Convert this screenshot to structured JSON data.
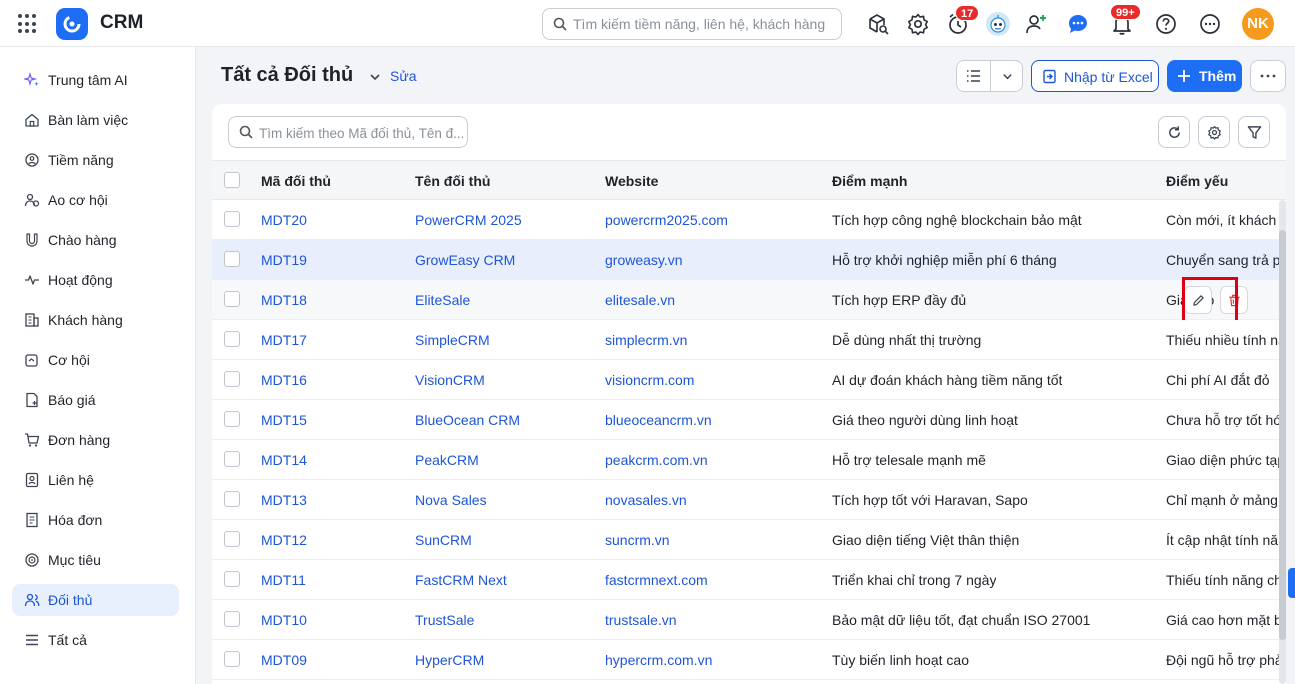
{
  "app": {
    "name": "CRM"
  },
  "topbar": {
    "search_placeholder": "Tìm kiếm tiềm năng, liên hệ, khách hàng",
    "reminder_badge": "17",
    "notification_badge": "99+",
    "user_initials": "NK",
    "icons": [
      "apps-grid-icon",
      "box-search-icon",
      "gear-icon",
      "alarm-clock-icon",
      "robot-avatar",
      "add-user-icon",
      "chat-icon",
      "bell-icon",
      "help-icon",
      "more-icon"
    ]
  },
  "sidebar": {
    "items": [
      {
        "label": "Trung tâm AI",
        "icon": "sparkle-icon"
      },
      {
        "label": "Bàn làm việc",
        "icon": "home-icon"
      },
      {
        "label": "Tiềm năng",
        "icon": "target-person-icon"
      },
      {
        "label": "Ao cơ hội",
        "icon": "people-pool-icon"
      },
      {
        "label": "Chào hàng",
        "icon": "magnet-icon"
      },
      {
        "label": "Hoạt động",
        "icon": "activity-icon"
      },
      {
        "label": "Khách hàng",
        "icon": "building-icon"
      },
      {
        "label": "Cơ hội",
        "icon": "opportunity-icon"
      },
      {
        "label": "Báo giá",
        "icon": "quote-icon"
      },
      {
        "label": "Đơn hàng",
        "icon": "cart-icon"
      },
      {
        "label": "Liên hệ",
        "icon": "contact-icon"
      },
      {
        "label": "Hóa đơn",
        "icon": "invoice-icon"
      },
      {
        "label": "Mục tiêu",
        "icon": "goal-icon"
      },
      {
        "label": "Đối thủ",
        "icon": "competitors-icon",
        "active": true
      },
      {
        "label": "Tất cả",
        "icon": "menu-icon"
      }
    ]
  },
  "page": {
    "title": "Tất cả Đối thủ",
    "edit_label": "Sửa",
    "import_label": "Nhập từ Excel",
    "add_label": "Thêm"
  },
  "list": {
    "search_placeholder": "Tìm kiếm theo Mã đối thủ, Tên đ...",
    "columns": [
      "Mã đối thủ",
      "Tên đối thủ",
      "Website",
      "Điểm mạnh",
      "Điểm yếu"
    ],
    "rows": [
      {
        "code": "MDT20",
        "name": "PowerCRM 2025",
        "website": "powercrm2025.com",
        "strength": "Tích hợp công nghệ blockchain bảo mật",
        "weakness": "Còn mới, ít khách h"
      },
      {
        "code": "MDT19",
        "name": "GrowEasy CRM",
        "website": "groweasy.vn",
        "strength": "Hỗ trợ khởi nghiệp miễn phí 6 tháng",
        "weakness": "Chuyển sang trả p"
      },
      {
        "code": "MDT18",
        "name": "EliteSale",
        "website": "elitesale.vn",
        "strength": "Tích hợp ERP đầy đủ",
        "weakness": "Giá cao"
      },
      {
        "code": "MDT17",
        "name": "SimpleCRM",
        "website": "simplecrm.vn",
        "strength": "Dễ dùng nhất thị trường",
        "weakness": "Thiếu nhiều tính nă"
      },
      {
        "code": "MDT16",
        "name": "VisionCRM",
        "website": "visioncrm.com",
        "strength": "AI dự đoán khách hàng tiềm năng tốt",
        "weakness": "Chi phí AI đắt đỏ"
      },
      {
        "code": "MDT15",
        "name": "BlueOcean CRM",
        "website": "blueoceancrm.vn",
        "strength": "Giá theo người dùng linh hoạt",
        "weakness": "Chưa hỗ trợ tốt hó"
      },
      {
        "code": "MDT14",
        "name": "PeakCRM",
        "website": "peakcrm.com.vn",
        "strength": "Hỗ trợ telesale mạnh mẽ",
        "weakness": "Giao diện phức tạp"
      },
      {
        "code": "MDT13",
        "name": "Nova Sales",
        "website": "novasales.vn",
        "strength": "Tích hợp tốt với Haravan, Sapo",
        "weakness": "Chỉ mạnh ở mảng b"
      },
      {
        "code": "MDT12",
        "name": "SunCRM",
        "website": "suncrm.vn",
        "strength": "Giao diện tiếng Việt thân thiện",
        "weakness": "Ít cập nhật tính năn"
      },
      {
        "code": "MDT11",
        "name": "FastCRM Next",
        "website": "fastcrmnext.com",
        "strength": "Triển khai chỉ trong 7 ngày",
        "weakness": "Thiếu tính năng ch"
      },
      {
        "code": "MDT10",
        "name": "TrustSale",
        "website": "trustsale.vn",
        "strength": "Bảo mật dữ liệu tốt, đạt chuẩn ISO 27001",
        "weakness": "Giá cao hơn mặt b"
      },
      {
        "code": "MDT09",
        "name": "HyperCRM",
        "website": "hypercrm.com.vn",
        "strength": "Tùy biến linh hoạt cao",
        "weakness": "Đội ngũ hỗ trợ phả"
      }
    ]
  },
  "colors": {
    "accent": "#1e6ef5",
    "link": "#1e55d6",
    "badge": "#ea2a2a",
    "avatar": "#f59a1c",
    "highlight_box": "#e00012"
  }
}
